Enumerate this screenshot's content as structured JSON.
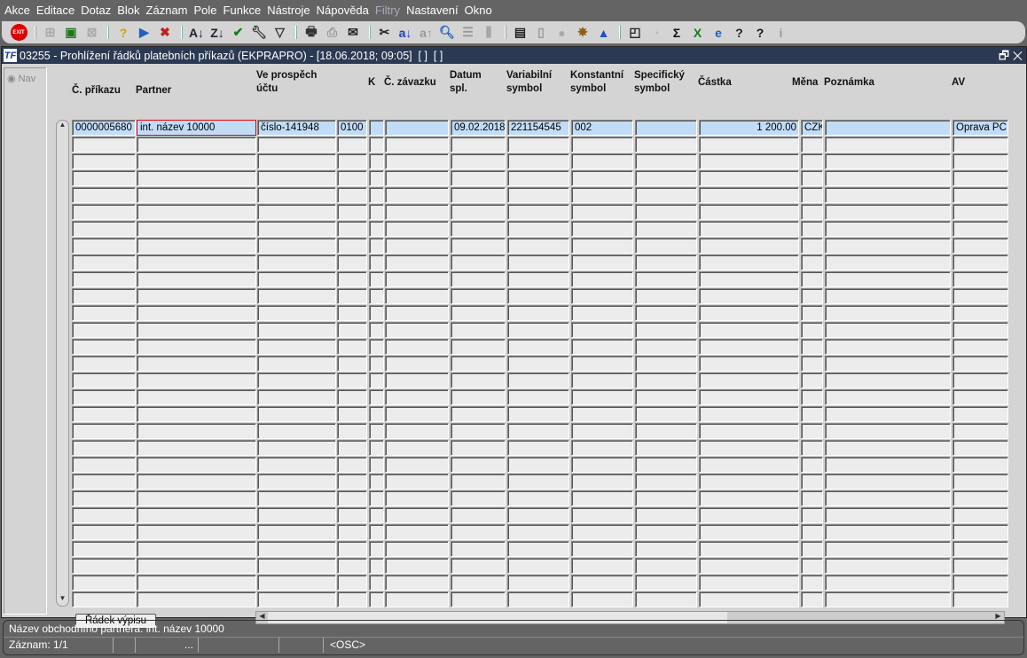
{
  "menu": [
    "Akce",
    "Editace",
    "Dotaz",
    "Blok",
    "Záznam",
    "Pole",
    "Funkce",
    "Nástroje",
    "Nápověda",
    "Filtry",
    "Nastavení",
    "Okno"
  ],
  "toolbar": {
    "exit_label": "EXIT",
    "icons": [
      {
        "name": "exit-icon"
      },
      {
        "sep": true
      },
      {
        "name": "insert-record-icon",
        "g": "⊞",
        "c": "#aaa"
      },
      {
        "name": "next-record-icon",
        "g": "▣",
        "c": "#1a7a1a"
      },
      {
        "name": "delete-record-icon",
        "g": "⊠",
        "c": "#aaa"
      },
      {
        "sep": true
      },
      {
        "name": "query-icon",
        "g": "?",
        "c": "#d8a000"
      },
      {
        "name": "execute-query-icon",
        "g": "▶",
        "c": "#2060c0"
      },
      {
        "name": "cancel-query-icon",
        "g": "✖",
        "c": "#c02020"
      },
      {
        "sep": true
      },
      {
        "name": "sort-ascending-icon",
        "g": "A↓",
        "c": "#223"
      },
      {
        "name": "sort-descending-icon",
        "g": "Z↓",
        "c": "#223"
      },
      {
        "name": "check-icon",
        "g": "✔",
        "c": "#1a7a1a"
      },
      {
        "name": "wrench-icon",
        "g": "🔧︎",
        "c": "#333"
      },
      {
        "name": "filter-icon",
        "g": "▽",
        "c": "#333"
      },
      {
        "sep": true
      },
      {
        "name": "print-icon",
        "g": "🖶︎",
        "c": "#333"
      },
      {
        "name": "print-setup-icon",
        "g": "⎙",
        "c": "#999"
      },
      {
        "name": "mail-icon",
        "g": "✉",
        "c": "#222"
      },
      {
        "sep": true
      },
      {
        "name": "scissors-icon",
        "g": "✂",
        "c": "#222"
      },
      {
        "name": "copy-down-icon",
        "g": "a↓",
        "c": "#2040b0"
      },
      {
        "name": "copy-up-icon",
        "g": "a↑",
        "c": "#999"
      },
      {
        "name": "zoom-icon",
        "g": "🔍︎",
        "c": "#2060c0"
      },
      {
        "name": "list-icon",
        "g": "☰",
        "c": "#999"
      },
      {
        "name": "columns-icon",
        "g": "⫼",
        "c": "#999"
      },
      {
        "sep": true
      },
      {
        "name": "export-icon",
        "g": "▤",
        "c": "#222"
      },
      {
        "name": "document-icon",
        "g": "▯",
        "c": "#999"
      },
      {
        "name": "globe-icon",
        "g": "●",
        "c": "#aaa"
      },
      {
        "name": "wheel-icon",
        "g": "✵",
        "c": "#8a5a10"
      },
      {
        "name": "eye-icon",
        "g": "▲",
        "c": "#2050c0"
      },
      {
        "sep": true
      },
      {
        "name": "chart-icon",
        "g": "◰",
        "c": "#222"
      },
      {
        "name": "calendar-icon",
        "g": "◔",
        "c": "#bbb"
      },
      {
        "name": "sum-icon",
        "g": "Σ",
        "c": "#111"
      },
      {
        "name": "excel-icon",
        "g": "X",
        "c": "#1a7a1a"
      },
      {
        "name": "browser-icon",
        "g": "e",
        "c": "#2060c0"
      },
      {
        "name": "help-icon",
        "g": "?",
        "c": "#222"
      },
      {
        "name": "context-help-icon",
        "g": "?",
        "c": "#111"
      },
      {
        "name": "info-icon",
        "g": "i",
        "c": "#999"
      }
    ]
  },
  "window": {
    "title": "03255 - Prohlížení řádků platebních příkazů (EKPRAPRO) - [18.06.2018; 09:05]  [ ]  [ ]",
    "restore": "🗗",
    "close": "✕",
    "nav": "Nav"
  },
  "columns": [
    "Č. příkazu",
    "Partner",
    "Ve prospěch\núčtu",
    "K",
    "Č. závazku",
    "Datum\nspl.",
    "Variabilní\nsymbol",
    "Konstantní\nsymbol",
    "Specifický\nsymbol",
    "Částka",
    "Měna",
    "Poznámka",
    "AV"
  ],
  "rows": [
    [
      "0000005680",
      "int. název 10000",
      "číslo-141948",
      "0100",
      "",
      "",
      "09.02.2018",
      "221154545",
      "002",
      "",
      "1 200.00",
      "CZK",
      "",
      "Oprava PC"
    ]
  ],
  "row_button": "Řádek výpisu",
  "status": {
    "message": "Název obchodního partnera: int. název 10000",
    "record": "Záznam: 1/1",
    "dots": "...",
    "mode": "<OSC>"
  }
}
